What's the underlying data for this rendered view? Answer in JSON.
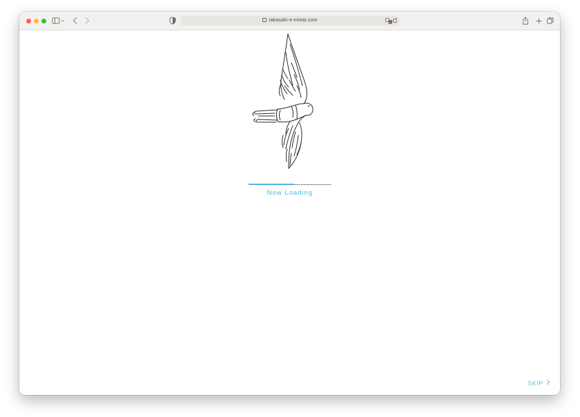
{
  "browser": {
    "url": "takasaki-e-mieai.com",
    "icons": {
      "sidebar": "sidebar-icon",
      "back": "chevron-left-icon",
      "forward": "chevron-right-icon",
      "privacy": "shield-icon",
      "translate": "translate-icon",
      "reload": "reload-icon",
      "share": "share-icon",
      "new_tab": "plus-icon",
      "tabs": "tabs-icon"
    }
  },
  "loader": {
    "text": "Now Loading",
    "progress": 0.55,
    "color": "#4db7e2"
  },
  "skip": {
    "label": "SKIP"
  }
}
